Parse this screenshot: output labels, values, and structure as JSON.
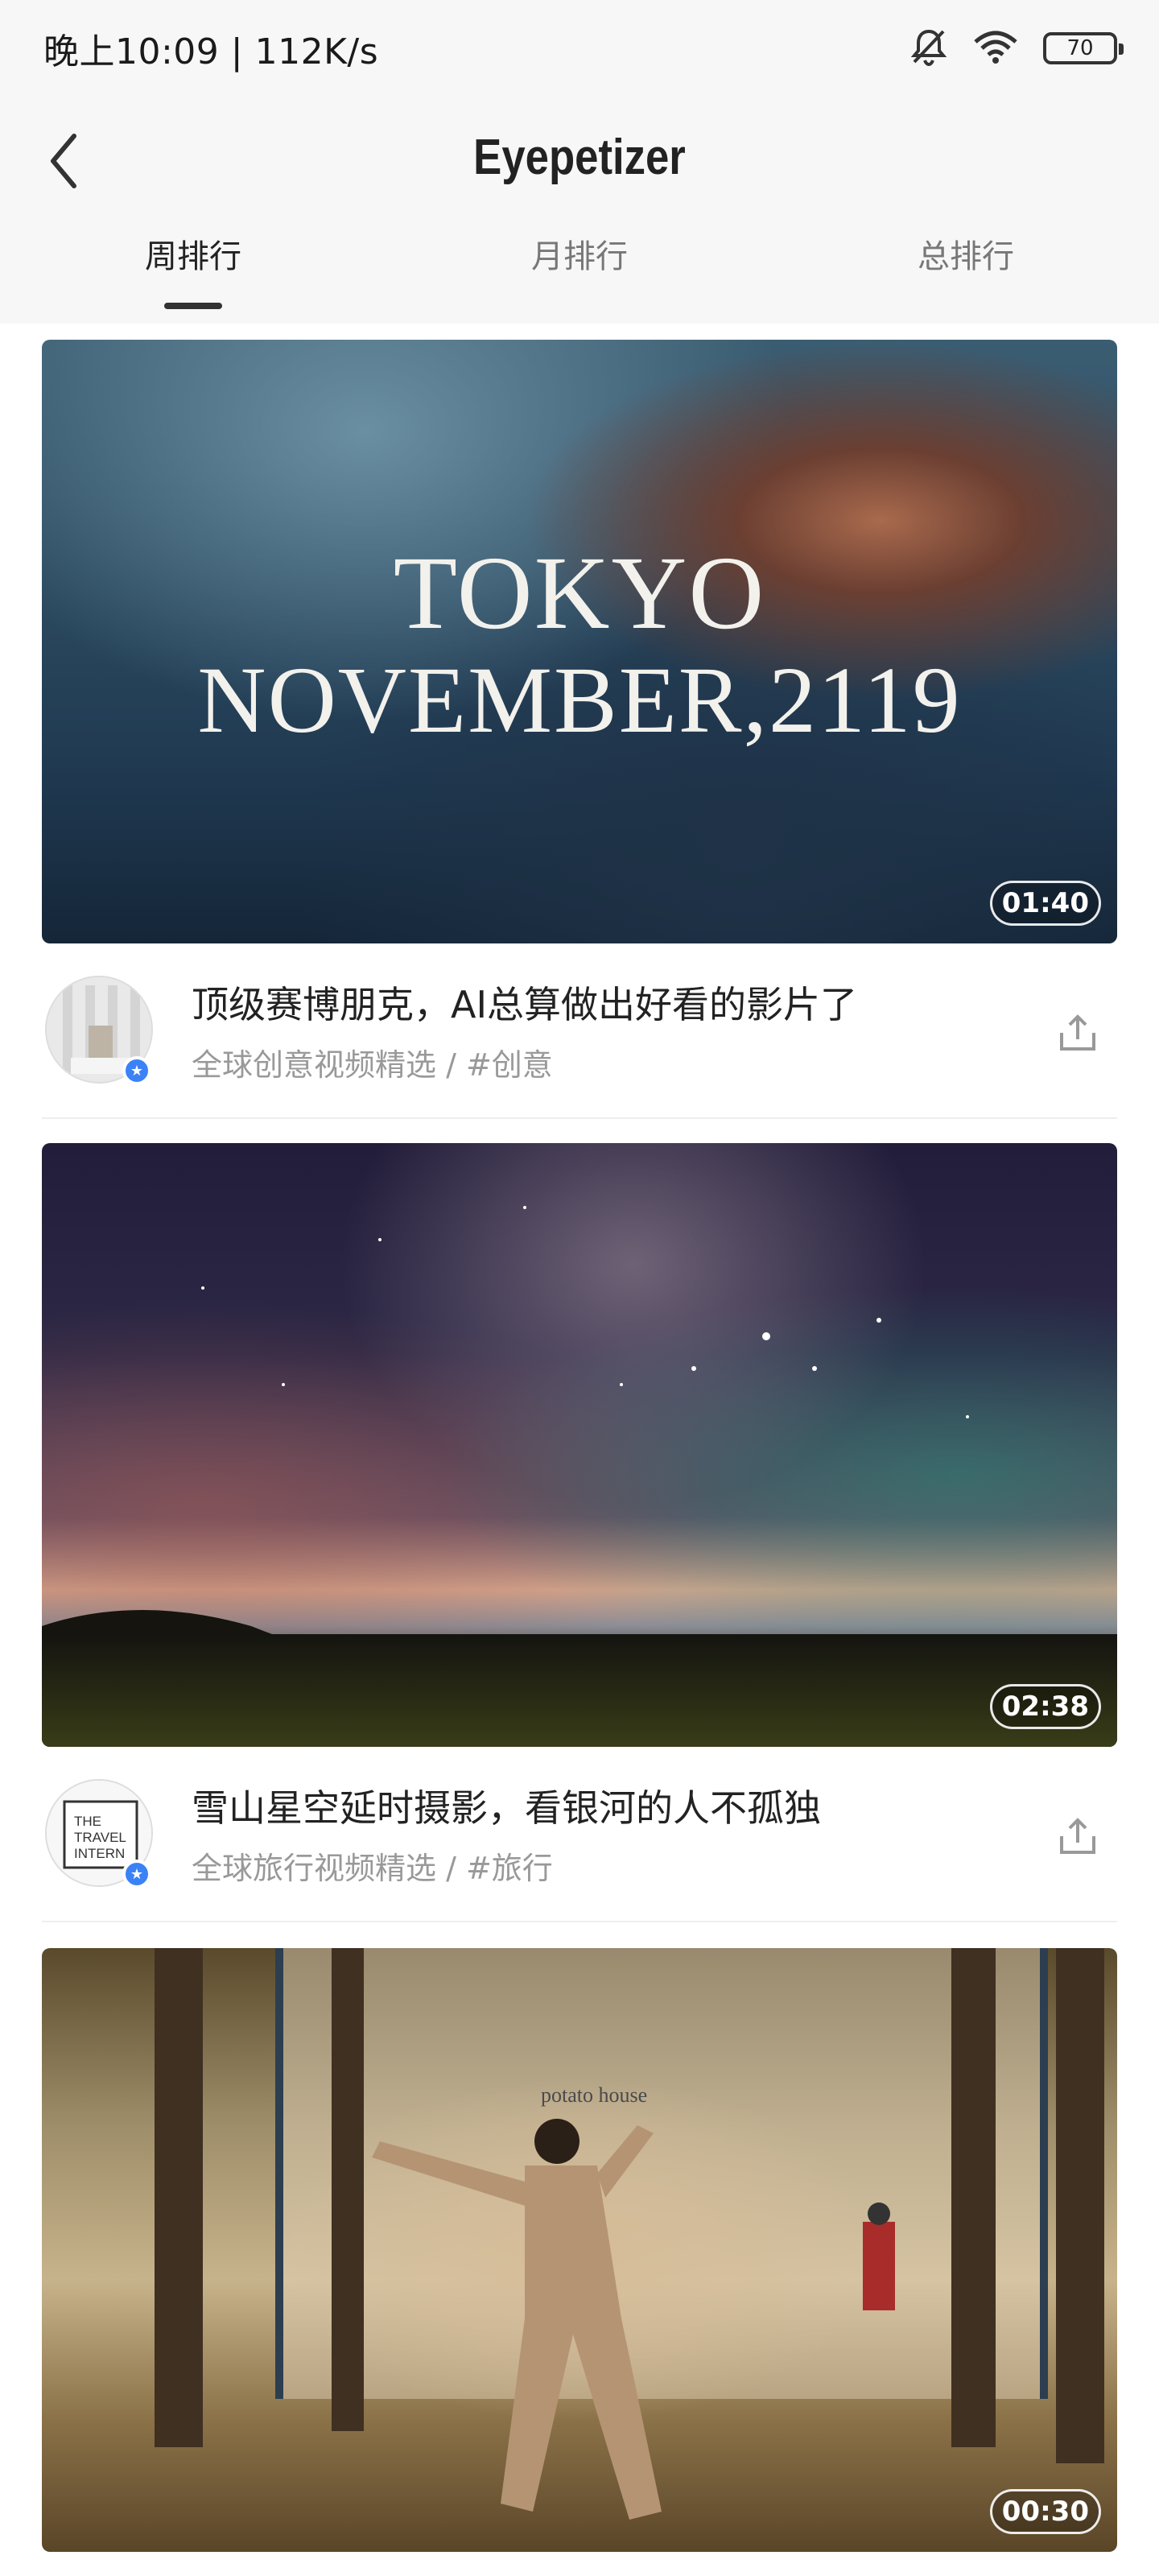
{
  "status_bar": {
    "time_speed": "晚上10:09 | 112K/s",
    "battery": "70",
    "icons": [
      "mute-icon",
      "wifi-icon",
      "battery-icon"
    ]
  },
  "header": {
    "title": "Eyepetizer",
    "tabs": [
      {
        "label": "周排行",
        "active": true
      },
      {
        "label": "月排行",
        "active": false
      },
      {
        "label": "总排行",
        "active": false
      }
    ]
  },
  "feed": [
    {
      "thumb_text_1": "TOKYO",
      "thumb_text_2": "NOVEMBER,2119",
      "duration": "01:40",
      "title": "顶级赛博朋克，AI总算做出好看的影片了",
      "subtitle": "全球创意视频精选  /  #创意"
    },
    {
      "duration": "02:38",
      "title": "雪山星空延时摄影，看银河的人不孤独",
      "subtitle": "全球旅行视频精选  /  #旅行",
      "avatar_text": "THE TRAVEL INTERN"
    },
    {
      "duration": "00:30",
      "store_sign": "potato house"
    }
  ],
  "colors": {
    "accent_badge": "#3b82f6",
    "header_bg": "#f7f7f7"
  }
}
